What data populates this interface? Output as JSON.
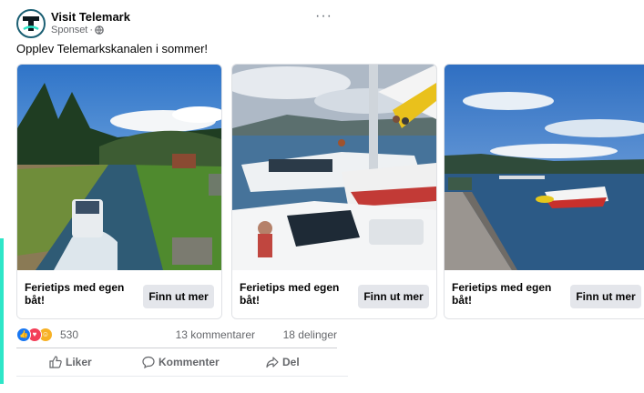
{
  "post": {
    "page_name": "Visit Telemark",
    "sponsored_label": "Sponset",
    "separator": "·",
    "text": "Opplev Telemarkskanalen i sommer!",
    "more_label": "···"
  },
  "cards": [
    {
      "title": "Ferietips med egen båt!",
      "cta": "Finn ut mer",
      "image": "canal-lock-boat-photo"
    },
    {
      "title": "Ferietips med egen båt!",
      "cta": "Finn ut mer",
      "image": "crowded-boats-harbor-photo"
    },
    {
      "title": "Ferietips med egen båt!",
      "cta": "Finn ut mer",
      "image": "lake-pier-speedboat-photo"
    }
  ],
  "stats": {
    "reaction_count": "530",
    "comments": "13 kommentarer",
    "shares": "18 delinger"
  },
  "actions": {
    "like": "Liker",
    "comment": "Kommenter",
    "share": "Del"
  },
  "colors": {
    "accent": "#2ee6c8",
    "like_blue": "#1877f2",
    "love_red": "#f33e58",
    "haha_yellow": "#f7b125",
    "logo_teal": "#1b5f73"
  }
}
